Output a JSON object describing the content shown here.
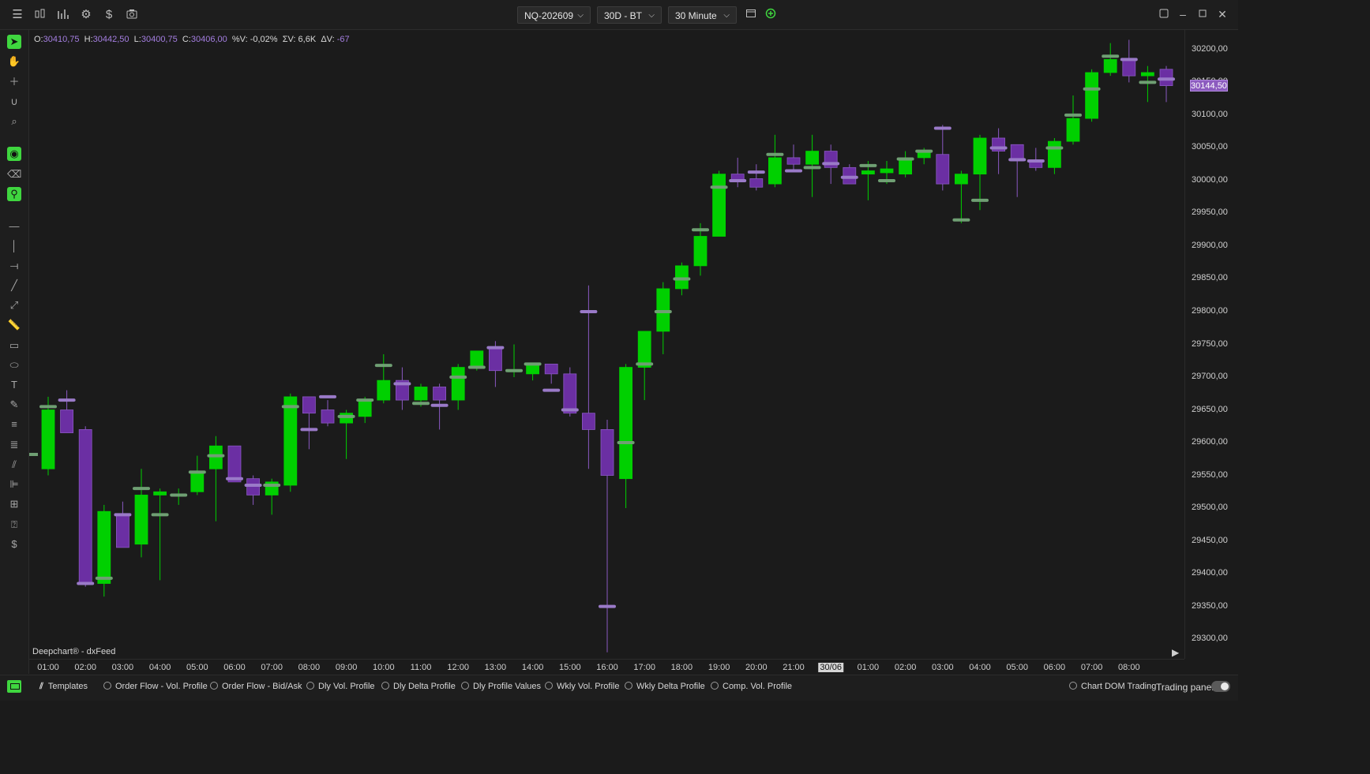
{
  "toolbar": {
    "symbol": "NQ-202609",
    "range": "30D - BT",
    "timeframe": "30 Minute"
  },
  "ohlc": {
    "o_label": "O:",
    "o": "30410,75",
    "h_label": "H:",
    "h": "30442,50",
    "l_label": "L:",
    "l": "30400,75",
    "c_label": "C:",
    "c": "30406,00",
    "pv_label": "%V:",
    "pv": "-0,02%",
    "sv_label": "ΣV:",
    "sv": "6,6K",
    "dv_label": "ΔV:",
    "dv": "-67"
  },
  "source_label": "Deepchart® - dxFeed",
  "price_axis": {
    "labels": [
      "30200,00",
      "30150,00",
      "30100,00",
      "30050,00",
      "30000,00",
      "29950,00",
      "29900,00",
      "29850,00",
      "29800,00",
      "29750,00",
      "29700,00",
      "29650,00",
      "29600,00",
      "29550,00",
      "29500,00",
      "29450,00",
      "29400,00",
      "29350,00",
      "29300,00"
    ],
    "current_price": "30144,50"
  },
  "time_axis": {
    "labels": [
      "01:00",
      "02:00",
      "03:00",
      "04:00",
      "05:00",
      "06:00",
      "07:00",
      "08:00",
      "09:00",
      "10:00",
      "11:00",
      "12:00",
      "13:00",
      "14:00",
      "15:00",
      "16:00",
      "17:00",
      "18:00",
      "19:00",
      "20:00",
      "21:00",
      "30/06",
      "01:00",
      "02:00",
      "03:00",
      "04:00",
      "05:00",
      "06:00",
      "07:00",
      "08:00"
    ]
  },
  "bottom": {
    "templates": "Templates",
    "items": [
      "Order Flow - Vol. Profile",
      "Order Flow - Bid/Ask",
      "Dly Vol. Profile",
      "Dly Delta Profile",
      "Dly Profile Values",
      "Wkly Vol. Profile",
      "Wkly Delta Profile",
      "Comp. Vol. Profile"
    ],
    "chart_dom": "Chart DOM Trading",
    "trading_panel": "Trading panel"
  },
  "colors": {
    "up": "#00d000",
    "down": "#6b2fa3",
    "poc_up": "#6f9f73",
    "poc_down": "#9a7ac8",
    "background": "#1b1b1b"
  },
  "chart_data": {
    "type": "candlestick",
    "ylim": [
      29270,
      30230
    ],
    "candles": [
      {
        "o": 29560,
        "h": 29670,
        "l": 29550,
        "c": 29650,
        "poc": 29655
      },
      {
        "o": 29650,
        "h": 29680,
        "l": 29615,
        "c": 29615,
        "poc": 29665
      },
      {
        "o": 29620,
        "h": 29625,
        "l": 29380,
        "c": 29385,
        "poc": 29385
      },
      {
        "o": 29385,
        "h": 29505,
        "l": 29365,
        "c": 29495,
        "poc": 29393
      },
      {
        "o": 29490,
        "h": 29510,
        "l": 29440,
        "c": 29440,
        "poc": 29490
      },
      {
        "o": 29445,
        "h": 29560,
        "l": 29425,
        "c": 29520,
        "poc": 29530
      },
      {
        "o": 29520,
        "h": 29530,
        "l": 29390,
        "c": 29525,
        "poc": 29490
      },
      {
        "o": 29520,
        "h": 29530,
        "l": 29505,
        "c": 29520,
        "poc": 29520
      },
      {
        "o": 29525,
        "h": 29580,
        "l": 29520,
        "c": 29555,
        "poc": 29555
      },
      {
        "o": 29560,
        "h": 29610,
        "l": 29480,
        "c": 29595,
        "poc": 29580
      },
      {
        "o": 29595,
        "h": 29595,
        "l": 29540,
        "c": 29540,
        "poc": 29545
      },
      {
        "o": 29545,
        "h": 29550,
        "l": 29505,
        "c": 29520,
        "poc": 29535
      },
      {
        "o": 29520,
        "h": 29545,
        "l": 29490,
        "c": 29540,
        "poc": 29535
      },
      {
        "o": 29535,
        "h": 29675,
        "l": 29525,
        "c": 29670,
        "poc": 29655
      },
      {
        "o": 29670,
        "h": 29670,
        "l": 29590,
        "c": 29645,
        "poc": 29620
      },
      {
        "o": 29650,
        "h": 29665,
        "l": 29625,
        "c": 29630,
        "poc": 29670
      },
      {
        "o": 29630,
        "h": 29650,
        "l": 29575,
        "c": 29645,
        "poc": 29640
      },
      {
        "o": 29640,
        "h": 29670,
        "l": 29630,
        "c": 29665,
        "poc": 29665
      },
      {
        "o": 29665,
        "h": 29735,
        "l": 29660,
        "c": 29695,
        "poc": 29718
      },
      {
        "o": 29695,
        "h": 29715,
        "l": 29650,
        "c": 29665,
        "poc": 29690
      },
      {
        "o": 29665,
        "h": 29690,
        "l": 29655,
        "c": 29685,
        "poc": 29660
      },
      {
        "o": 29685,
        "h": 29690,
        "l": 29620,
        "c": 29665,
        "poc": 29657
      },
      {
        "o": 29665,
        "h": 29720,
        "l": 29650,
        "c": 29715,
        "poc": 29700
      },
      {
        "o": 29715,
        "h": 29740,
        "l": 29710,
        "c": 29740,
        "poc": 29715
      },
      {
        "o": 29745,
        "h": 29755,
        "l": 29685,
        "c": 29710,
        "poc": 29745
      },
      {
        "o": 29710,
        "h": 29750,
        "l": 29700,
        "c": 29710,
        "poc": 29710
      },
      {
        "o": 29705,
        "h": 29720,
        "l": 29695,
        "c": 29720,
        "poc": 29720
      },
      {
        "o": 29720,
        "h": 29720,
        "l": 29690,
        "c": 29705,
        "poc": 29680
      },
      {
        "o": 29705,
        "h": 29715,
        "l": 29640,
        "c": 29645,
        "poc": 29650
      },
      {
        "o": 29645,
        "h": 29840,
        "l": 29560,
        "c": 29620,
        "poc": 29800
      },
      {
        "o": 29620,
        "h": 29635,
        "l": 29280,
        "c": 29550,
        "poc": 29350
      },
      {
        "o": 29545,
        "h": 29720,
        "l": 29500,
        "c": 29715,
        "poc": 29600
      },
      {
        "o": 29715,
        "h": 29770,
        "l": 29665,
        "c": 29770,
        "poc": 29720
      },
      {
        "o": 29770,
        "h": 29845,
        "l": 29735,
        "c": 29835,
        "poc": 29800
      },
      {
        "o": 29835,
        "h": 29875,
        "l": 29825,
        "c": 29870,
        "poc": 29850
      },
      {
        "o": 29870,
        "h": 29935,
        "l": 29855,
        "c": 29915,
        "poc": 29925
      },
      {
        "o": 29915,
        "h": 30015,
        "l": 29915,
        "c": 30010,
        "poc": 29990
      },
      {
        "o": 30010,
        "h": 30035,
        "l": 29990,
        "c": 29998,
        "poc": 30000
      },
      {
        "o": 30003,
        "h": 30025,
        "l": 29985,
        "c": 29990,
        "poc": 30013
      },
      {
        "o": 29995,
        "h": 30070,
        "l": 29990,
        "c": 30035,
        "poc": 30040
      },
      {
        "o": 30035,
        "h": 30055,
        "l": 30015,
        "c": 30025,
        "poc": 30015
      },
      {
        "o": 30025,
        "h": 30070,
        "l": 29975,
        "c": 30045,
        "poc": 30020
      },
      {
        "o": 30045,
        "h": 30055,
        "l": 29995,
        "c": 30020,
        "poc": 30026
      },
      {
        "o": 30020,
        "h": 30025,
        "l": 29995,
        "c": 29995,
        "poc": 30005
      },
      {
        "o": 30010,
        "h": 30030,
        "l": 29970,
        "c": 30015,
        "poc": 30023
      },
      {
        "o": 30012,
        "h": 30030,
        "l": 29995,
        "c": 30018,
        "poc": 30000
      },
      {
        "o": 30010,
        "h": 30045,
        "l": 30005,
        "c": 30035,
        "poc": 30033
      },
      {
        "o": 30035,
        "h": 30050,
        "l": 30025,
        "c": 30045,
        "poc": 30045
      },
      {
        "o": 30040,
        "h": 30085,
        "l": 29985,
        "c": 29995,
        "poc": 30080
      },
      {
        "o": 29995,
        "h": 30015,
        "l": 29935,
        "c": 30010,
        "poc": 29940
      },
      {
        "o": 30010,
        "h": 30070,
        "l": 29955,
        "c": 30065,
        "poc": 29970
      },
      {
        "o": 30065,
        "h": 30080,
        "l": 30010,
        "c": 30045,
        "poc": 30050
      },
      {
        "o": 30055,
        "h": 30055,
        "l": 29975,
        "c": 30030,
        "poc": 30032
      },
      {
        "o": 30030,
        "h": 30050,
        "l": 30015,
        "c": 30020,
        "poc": 30030
      },
      {
        "o": 30020,
        "h": 30065,
        "l": 30010,
        "c": 30060,
        "poc": 30050
      },
      {
        "o": 30060,
        "h": 30130,
        "l": 30055,
        "c": 30095,
        "poc": 30100
      },
      {
        "o": 30095,
        "h": 30170,
        "l": 30090,
        "c": 30165,
        "poc": 30140
      },
      {
        "o": 30165,
        "h": 30210,
        "l": 30160,
        "c": 30185,
        "poc": 30190
      },
      {
        "o": 30185,
        "h": 30215,
        "l": 30150,
        "c": 30160,
        "poc": 30185
      },
      {
        "o": 30160,
        "h": 30175,
        "l": 30120,
        "c": 30165,
        "poc": 30150
      },
      {
        "o": 30170,
        "h": 30175,
        "l": 30120,
        "c": 30145,
        "poc": 30155
      }
    ]
  }
}
